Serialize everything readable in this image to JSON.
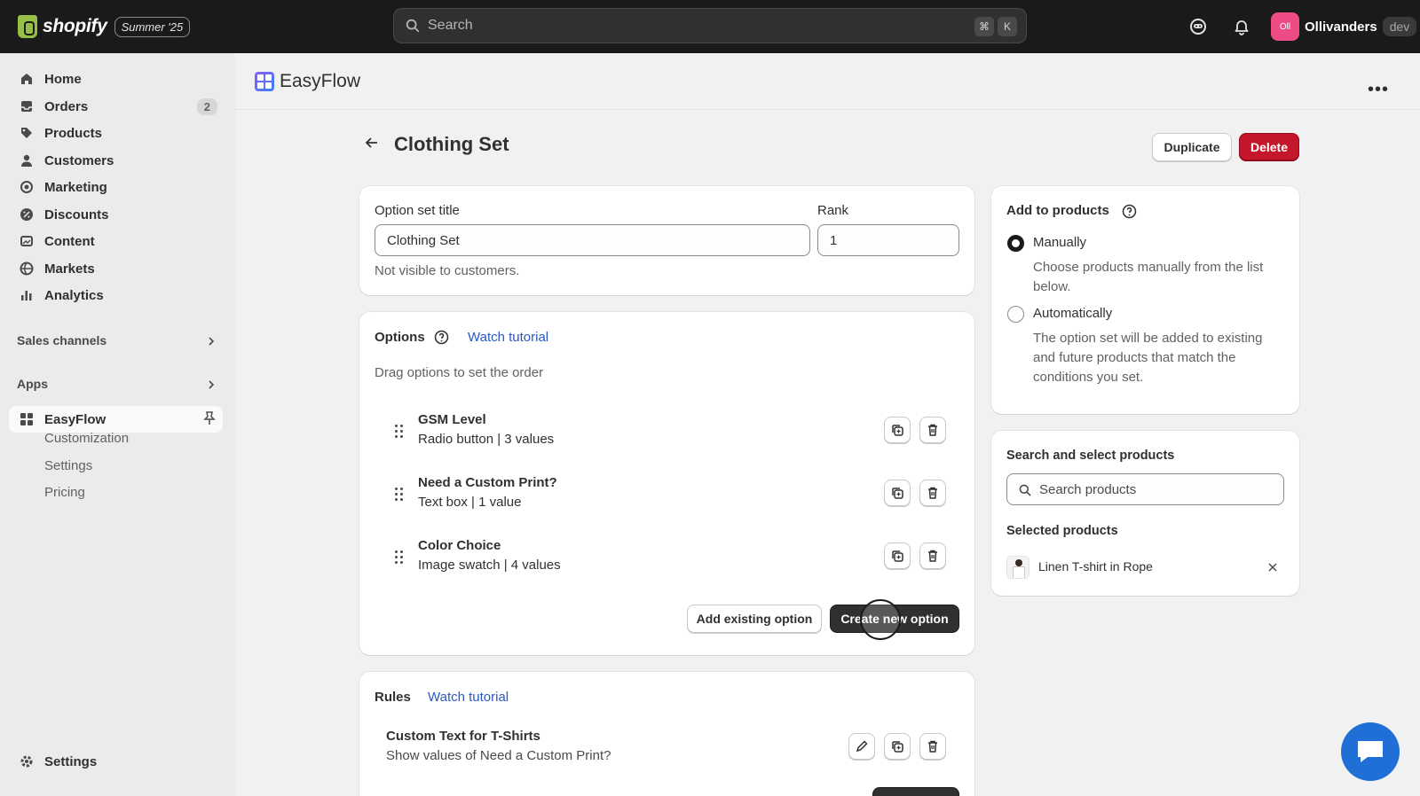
{
  "topbar": {
    "brand": "shopify",
    "edition": "Summer '25",
    "search_placeholder": "Search",
    "shortcut_keys": [
      "⌘",
      "K"
    ],
    "store_initials": "Oll",
    "store_name": "Ollivanders",
    "store_badge": "dev"
  },
  "sidebar": {
    "items": [
      {
        "label": "Home",
        "icon": "home-icon"
      },
      {
        "label": "Orders",
        "icon": "inbox-icon",
        "count": "2"
      },
      {
        "label": "Products",
        "icon": "tag-icon"
      },
      {
        "label": "Customers",
        "icon": "person-icon"
      },
      {
        "label": "Marketing",
        "icon": "target-icon"
      },
      {
        "label": "Discounts",
        "icon": "discount-icon"
      },
      {
        "label": "Content",
        "icon": "image-icon"
      },
      {
        "label": "Markets",
        "icon": "globe-icon"
      },
      {
        "label": "Analytics",
        "icon": "bar-chart-icon"
      }
    ],
    "sales_channels": "Sales channels",
    "apps": "Apps",
    "app_item": "EasyFlow",
    "app_subitems": [
      "Customization",
      "Settings",
      "Pricing"
    ],
    "settings": "Settings"
  },
  "app_header": {
    "title": "EasyFlow"
  },
  "page": {
    "title": "Clothing Set",
    "duplicate": "Duplicate",
    "delete": "Delete"
  },
  "details": {
    "title_label": "Option set title",
    "title_value": "Clothing Set",
    "rank_label": "Rank",
    "rank_value": "1",
    "help": "Not visible to customers."
  },
  "options": {
    "heading": "Options",
    "tutorial": "Watch tutorial",
    "hint": "Drag options to set the order",
    "items": [
      {
        "title": "GSM Level",
        "subtitle": "Radio button | 3 values"
      },
      {
        "title": "Need a Custom Print?",
        "subtitle": "Text box | 1 value"
      },
      {
        "title": "Color Choice",
        "subtitle": "Image swatch | 4 values"
      }
    ],
    "add_existing": "Add existing option",
    "create_new": "Create new option"
  },
  "rules": {
    "heading": "Rules",
    "tutorial": "Watch tutorial",
    "item_title": "Custom Text for T-Shirts",
    "item_subtitle": "Show values of Need a Custom Print?"
  },
  "add_to_products": {
    "heading": "Add to products",
    "manual_label": "Manually",
    "manual_desc": "Choose products manually from the list below.",
    "auto_label": "Automatically",
    "auto_desc": "The option set will be added to existing and future products that match the conditions you set.",
    "selected_mode": "Manually"
  },
  "product_search": {
    "heading": "Search and select products",
    "placeholder": "Search products",
    "selected_heading": "Selected products",
    "selected_items": [
      "Linen T-shirt in Rope"
    ]
  },
  "colors": {
    "topbar": "#1a1a1a",
    "delete": "#c5172b",
    "link": "#2a58c4",
    "chat": "#1f6fd6",
    "avatar": "#ec4b86"
  }
}
